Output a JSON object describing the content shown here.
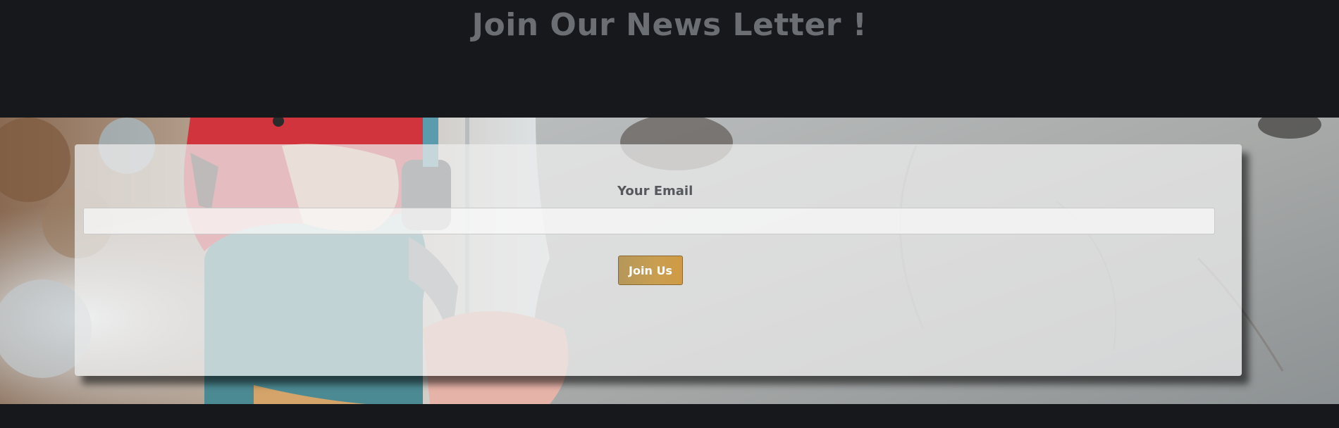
{
  "newsletter": {
    "title": "Join Our News Letter !",
    "email_label": "Your Email",
    "email_value": "",
    "email_placeholder": "",
    "submit_label": "Join Us"
  },
  "colors": {
    "page_background": "#17181b",
    "title_text": "#6b6f74",
    "button_gold": "#c99e50"
  },
  "hero_image": {
    "subject": "rock-climber-with-red-helmet"
  }
}
